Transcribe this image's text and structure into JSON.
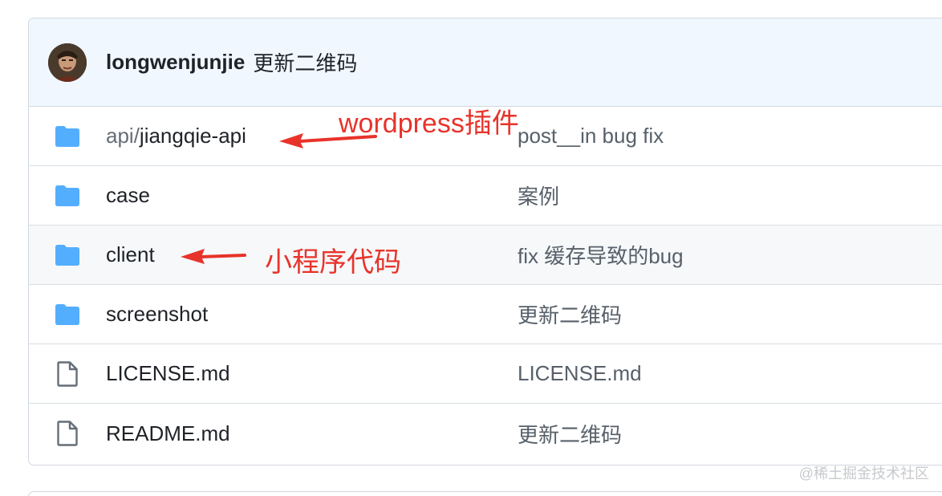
{
  "commit": {
    "author": "longwenjunjie",
    "message": "更新二维码"
  },
  "files": [
    {
      "type": "folder",
      "icon": "folder-icon",
      "prefix": "api/",
      "name": "jiangqie-api",
      "commit": "post__in bug fix"
    },
    {
      "type": "folder",
      "icon": "folder-icon",
      "prefix": "",
      "name": "case",
      "commit": "案例"
    },
    {
      "type": "folder",
      "icon": "folder-icon",
      "prefix": "",
      "name": "client",
      "commit": "fix 缓存导致的bug"
    },
    {
      "type": "folder",
      "icon": "folder-icon",
      "prefix": "",
      "name": "screenshot",
      "commit": "更新二维码"
    },
    {
      "type": "file",
      "icon": "file-icon",
      "prefix": "",
      "name": "LICENSE.md",
      "commit": "LICENSE.md"
    },
    {
      "type": "file",
      "icon": "file-icon",
      "prefix": "",
      "name": "README.md",
      "commit": "更新二维码"
    }
  ],
  "annotations": {
    "api": "wordpress插件",
    "client": "小程序代码"
  },
  "watermark": "@稀土掘金技术社区",
  "colors": {
    "folder": "#54aeff",
    "file_icon": "#656d76",
    "annotation": "#e8332a",
    "header_bg": "#f0f7ff"
  }
}
